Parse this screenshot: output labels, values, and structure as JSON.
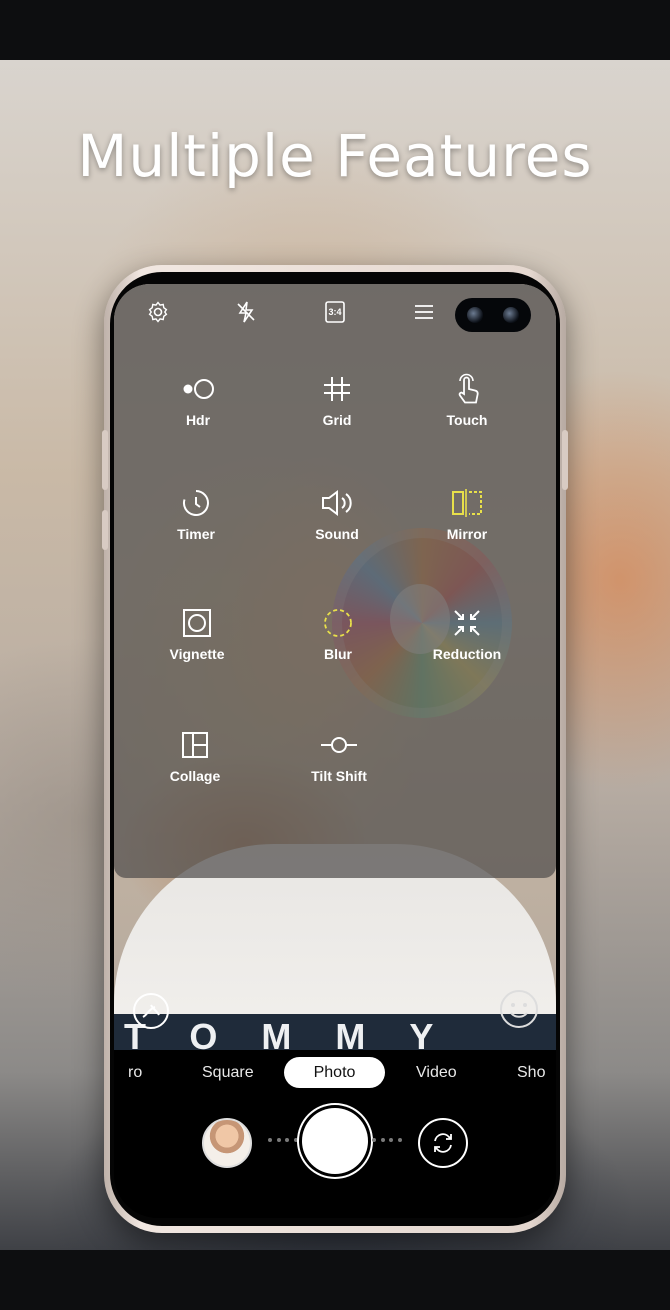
{
  "headline": "Multiple Features",
  "camera_top_bar": {
    "icons": [
      "settings-icon",
      "flash-off-icon",
      "aspect-ratio-icon",
      "menu-icon"
    ],
    "aspect_ratio": "3:4"
  },
  "features": [
    {
      "label": "Hdr",
      "icon": "hdr-icon"
    },
    {
      "label": "Grid",
      "icon": "grid-icon"
    },
    {
      "label": "Touch",
      "icon": "touch-icon"
    },
    {
      "label": "Timer",
      "icon": "timer-icon"
    },
    {
      "label": "Sound",
      "icon": "sound-icon"
    },
    {
      "label": "Mirror",
      "icon": "mirror-icon",
      "active": true
    },
    {
      "label": "Vignette",
      "icon": "vignette-icon"
    },
    {
      "label": "Blur",
      "icon": "blur-icon",
      "active": true
    },
    {
      "label": "Reduction",
      "icon": "reduction-icon"
    },
    {
      "label": "Collage",
      "icon": "collage-icon"
    },
    {
      "label": "Tilt Shift",
      "icon": "tilt-shift-icon"
    }
  ],
  "photo": {
    "shirt_text": "TOMMY"
  },
  "modes": [
    "ro",
    "Square",
    "Photo",
    "Video",
    "Sho"
  ],
  "active_mode": "Photo",
  "colors": {
    "active_feature": "#e8e04a",
    "overlay": "#504e4c"
  }
}
